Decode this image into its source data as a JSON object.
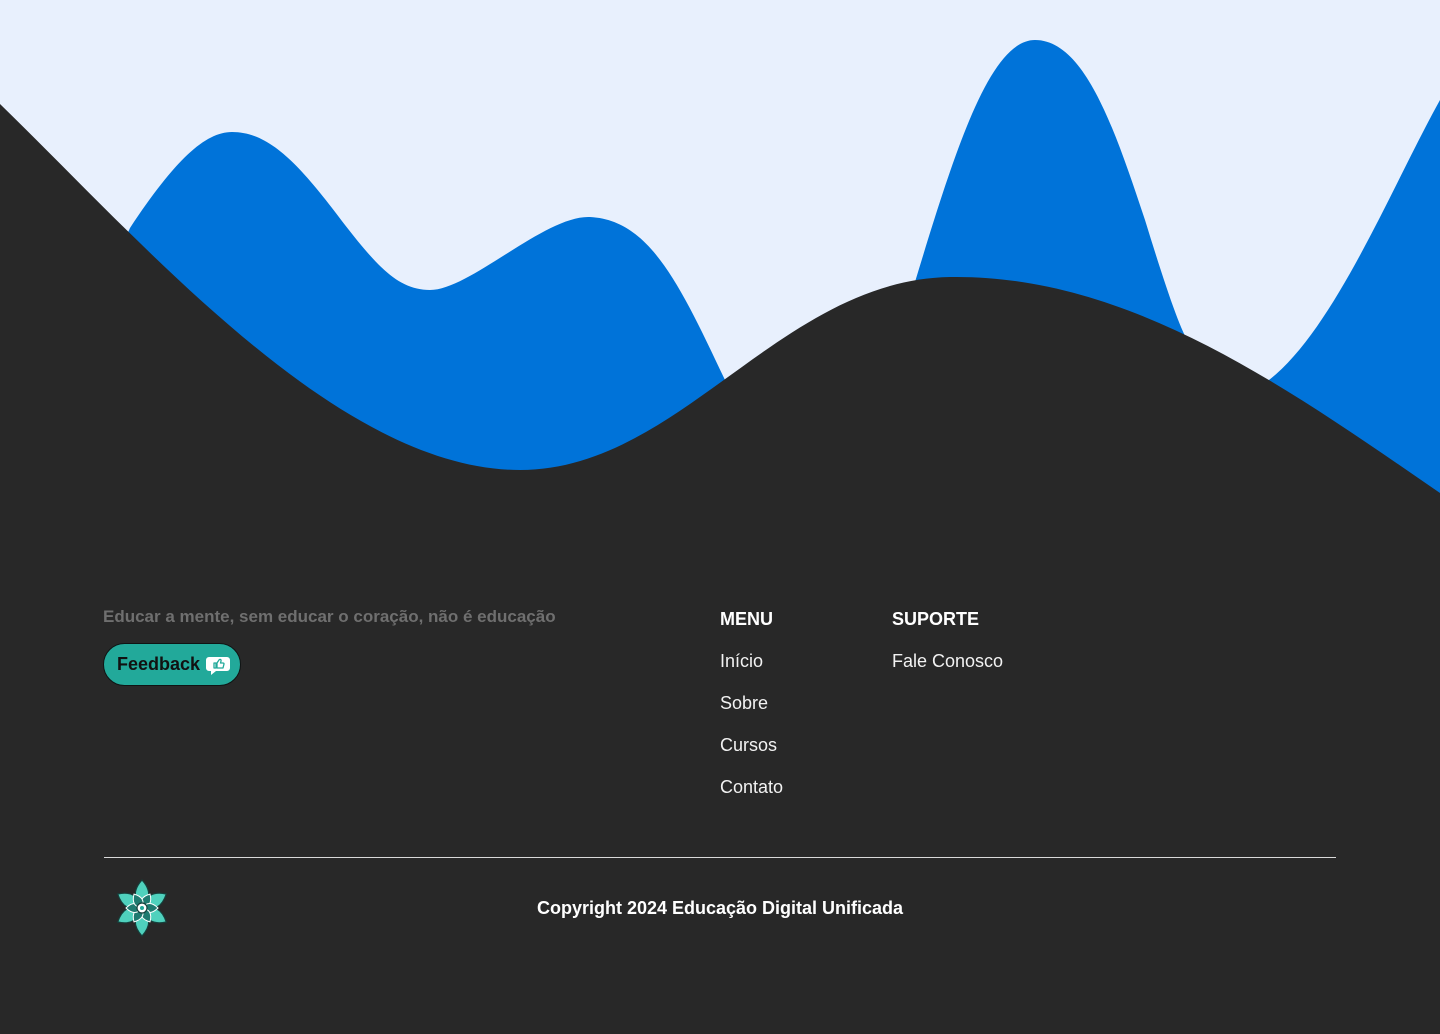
{
  "colors": {
    "sky": "#e8f0fd",
    "wave_blue": "#0073d9",
    "footer_dark": "#282828",
    "accent_teal": "#22a99a"
  },
  "footer": {
    "tagline": "Educar a mente, sem educar o coração, não é educação",
    "feedback": {
      "label": "Feedback",
      "icon": "thumbs-up-bubble-icon"
    },
    "menu": {
      "heading": "MENU",
      "items": [
        "Início",
        "Sobre",
        "Cursos",
        "Contato"
      ]
    },
    "support": {
      "heading": "SUPORTE",
      "items": [
        "Fale Conosco"
      ]
    },
    "logo_icon": "lotus-flower-icon",
    "copyright": "Copyright 2024 Educação Digital Unificada"
  }
}
